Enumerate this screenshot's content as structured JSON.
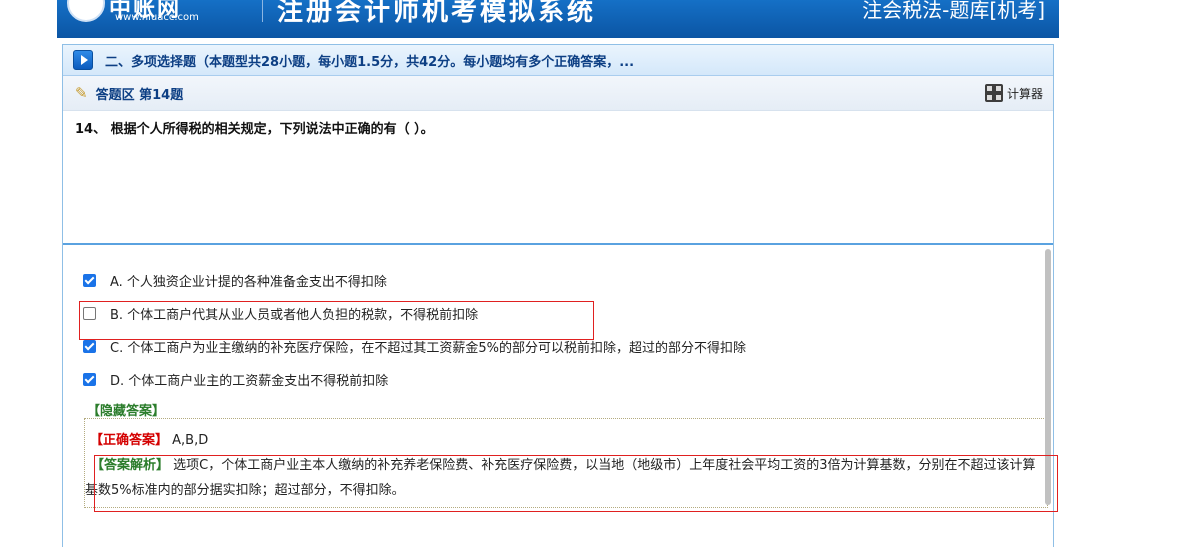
{
  "banner": {
    "brand": "中账网",
    "url": "www.niuacc.com",
    "title": "注册会计师机考模拟系统",
    "right_title": "注会税法-题库[机考]"
  },
  "section": {
    "title": "二、多项选择题（本题型共28小题，每小题1.5分，共42分。每小题均有多个正确答案，..."
  },
  "answer_area": {
    "label": "答题区 第14题",
    "calculator_label": "计算器"
  },
  "question": {
    "text": "14、 根据个人所得税的相关规定，下列说法中正确的有（   ）。"
  },
  "options": [
    {
      "label": "A. 个人独资企业计提的各种准备金支出不得扣除",
      "checked": true
    },
    {
      "label": "B. 个体工商户代其从业人员或者他人负担的税款，不得税前扣除",
      "checked": false
    },
    {
      "label": "C. 个体工商户为业主缴纳的补充医疗保险，在不超过其工资薪金5%的部分可以税前扣除，超过的部分不得扣除",
      "checked": true
    },
    {
      "label": "D. 个体工商户业主的工资薪金支出不得税前扣除",
      "checked": true
    }
  ],
  "hide_answer": "【隐藏答案】",
  "correct": {
    "label": "【正确答案】",
    "value": "A,B,D"
  },
  "analysis": {
    "label": "【答案解析】",
    "text": "选项C，个体工商户业主本人缴纳的补充养老保险费、补充医疗保险费，以当地（地级市）上年度社会平均工资的3倍为计算基数，分别在不超过该计算基数5%标准内的部分据实扣除；超过部分，不得扣除。"
  },
  "colors": {
    "banner": "#0b55a4",
    "highlight": "#e02020",
    "correct_label": "#d40000",
    "analysis_label": "#2c7d2c",
    "checkbox": "#1a73e8"
  }
}
